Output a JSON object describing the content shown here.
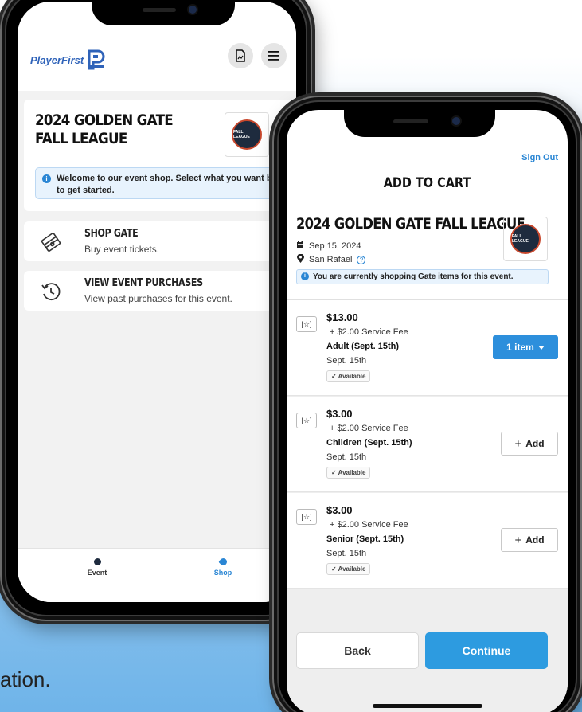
{
  "background": {
    "caption": "ation."
  },
  "back_screen": {
    "brand": "PlayerFirst",
    "event": {
      "title": "2024 GOLDEN GATE FALL LEAGUE",
      "logo_text": "FALL LEAGUE",
      "welcome": "Welcome to our event shop. Select what you want below to get started."
    },
    "menu": [
      {
        "title": "SHOP GATE",
        "subtitle": "Buy event tickets."
      },
      {
        "title": "VIEW EVENT PURCHASES",
        "subtitle": "View past purchases for this event."
      }
    ],
    "nav": {
      "event": "Event",
      "shop": "Shop"
    }
  },
  "front_screen": {
    "sign_out": "Sign Out",
    "page_title": "ADD TO CART",
    "event": {
      "title": "2024 GOLDEN GATE FALL LEAGUE",
      "date": "Sep 15, 2024",
      "location": "San Rafael",
      "logo_text": "FALL LEAGUE",
      "banner": "You are currently shopping Gate items for this event."
    },
    "items": [
      {
        "price": "$13.00",
        "fee": "+ $2.00 Service Fee",
        "name": "Adult (Sept. 15th)",
        "date": "Sept. 15th",
        "status": "✓ Available",
        "button": "1 item"
      },
      {
        "price": "$3.00",
        "fee": "+ $2.00 Service Fee",
        "name": "Children (Sept. 15th)",
        "date": "Sept. 15th",
        "status": "✓ Available",
        "button": "Add"
      },
      {
        "price": "$3.00",
        "fee": "+ $2.00 Service Fee",
        "name": "Senior (Sept. 15th)",
        "date": "Sept. 15th",
        "status": "✓ Available",
        "button": "Add"
      }
    ],
    "buttons": {
      "back": "Back",
      "continue": "Continue"
    }
  },
  "colors": {
    "accent_blue": "#2d8fdc",
    "link_blue": "#2a86d4",
    "brand_blue": "#2f63b9"
  }
}
